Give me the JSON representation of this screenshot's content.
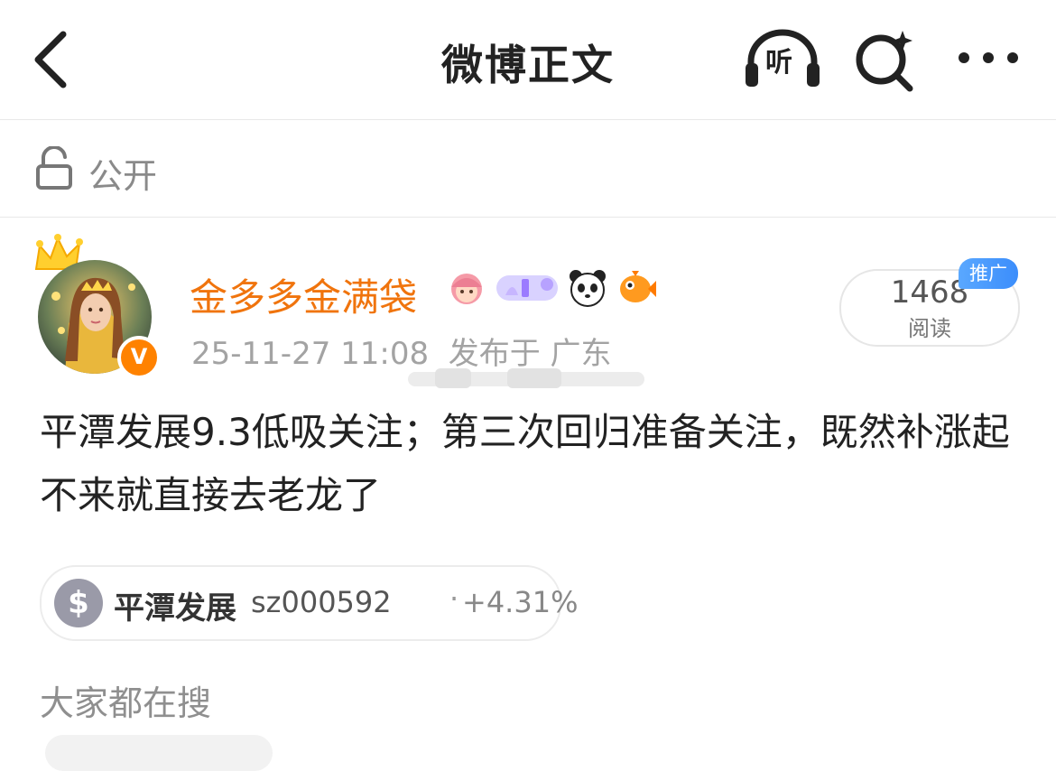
{
  "header": {
    "title": "微博正文",
    "listen_label": "听"
  },
  "visibility": {
    "label": "公开"
  },
  "author": {
    "name": "金多多金满袋",
    "verified_badge": "V",
    "time": "25-11-27 11:08",
    "location": "发布于 广东",
    "badge_icons": [
      "girl-emoji-icon",
      "member-pill-icon",
      "panda-icon",
      "fish-icon"
    ]
  },
  "read": {
    "count": "1468",
    "label": "阅读",
    "promo": "推广"
  },
  "post": {
    "text": "平潭发展9.3低吸关注；第三次回归准备关注，既然补涨起不来就直接去老龙了"
  },
  "stock": {
    "symbol_icon": "$",
    "name": "平潭发展",
    "code": "sz000592",
    "separator": "·",
    "change": "+4.31%"
  },
  "hot_search": {
    "label": "大家都在搜"
  },
  "colors": {
    "username": "#f0740d",
    "verified": "#ff8200",
    "promo": "#3b8dfb"
  }
}
